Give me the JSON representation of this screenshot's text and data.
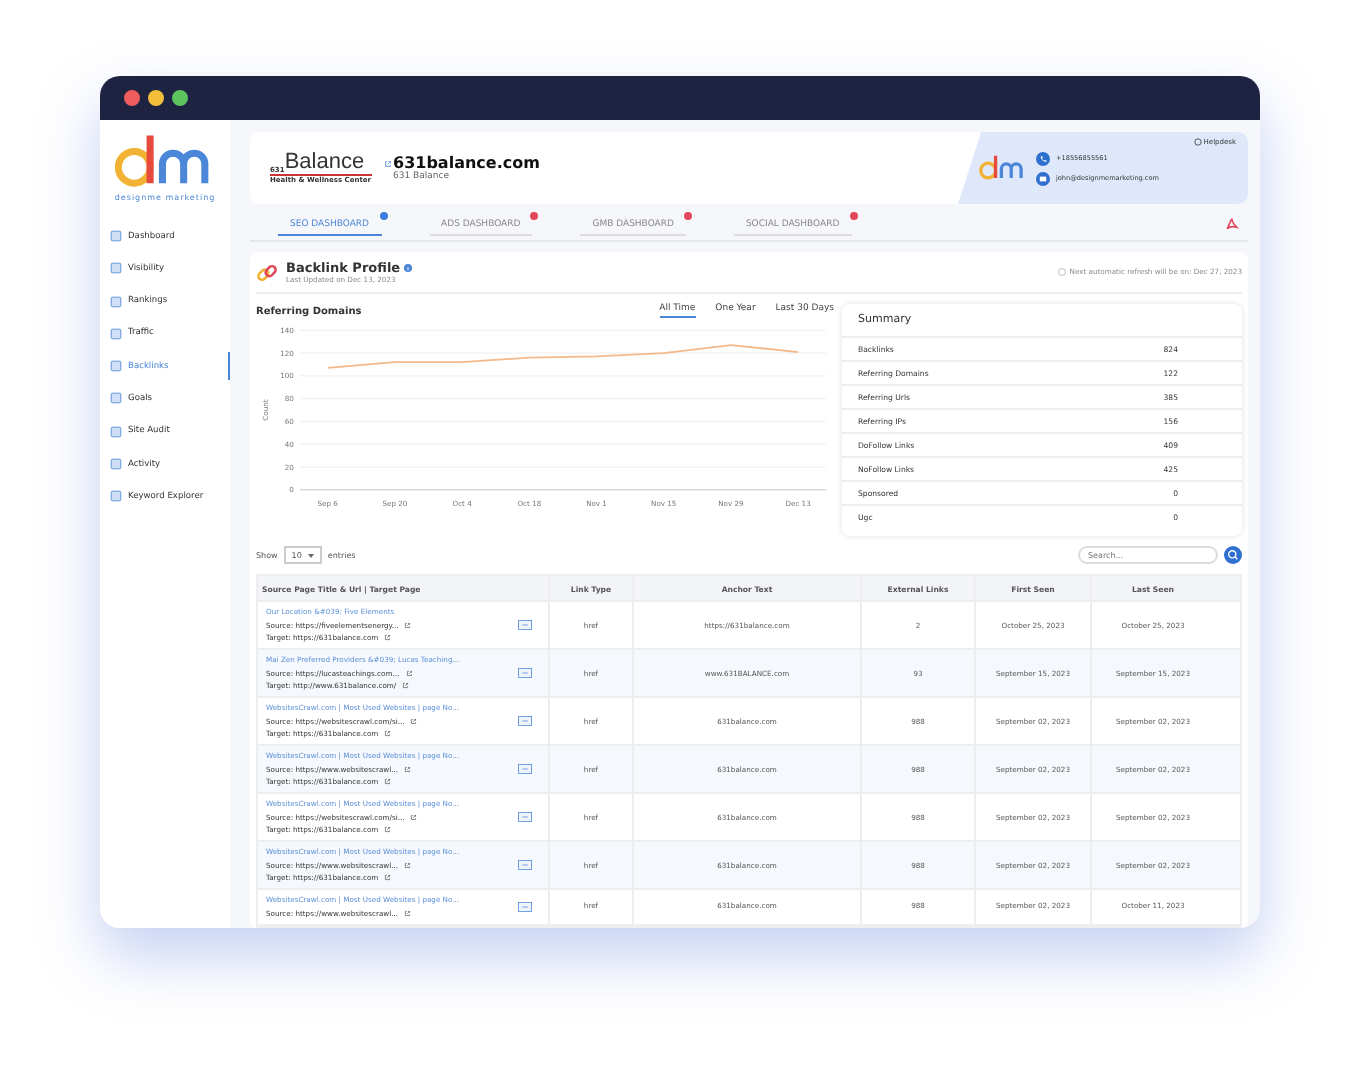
{
  "brand": {
    "logo_text": "designme marketing"
  },
  "sidebar": {
    "items": [
      {
        "label": "Dashboard",
        "selected": false
      },
      {
        "label": "Visibility",
        "selected": false
      },
      {
        "label": "Rankings",
        "selected": false
      },
      {
        "label": "Traffic",
        "selected": false
      },
      {
        "label": "Backlinks",
        "selected": true
      },
      {
        "label": "Goals",
        "selected": false
      },
      {
        "label": "Site Audit",
        "selected": false
      },
      {
        "label": "Activity",
        "selected": false
      },
      {
        "label": "Keyword Explorer",
        "selected": false
      }
    ]
  },
  "client": {
    "logo_prefix": "631",
    "logo_name": "Balance",
    "logo_tagline": "Health & Wellness Center",
    "domain": "631balance.com",
    "name": "631 Balance"
  },
  "contact": {
    "helpdesk": "Helpdesk",
    "phone": "+18556855561",
    "email": "john@designmemarketing.com"
  },
  "tabs": [
    {
      "label": "SEO DASHBOARD",
      "selected": true,
      "color": "#3b7ddd"
    },
    {
      "label": "ADS DASHBOARD",
      "selected": false,
      "color": "#e0475b"
    },
    {
      "label": "GMB DASHBOARD",
      "selected": false,
      "color": "#e0475b"
    },
    {
      "label": "SOCIAL DASHBOARD",
      "selected": false,
      "color": "#e0475b"
    }
  ],
  "profile": {
    "title": "Backlink Profile",
    "updated": "Last Updated on Dec 13, 2023",
    "refresh": "Next automatic refresh will be on: Dec 27, 2023"
  },
  "referring": {
    "title": "Referring Domains",
    "ranges": [
      {
        "label": "All Time",
        "selected": true
      },
      {
        "label": "One Year",
        "selected": false
      },
      {
        "label": "Last 30 Days",
        "selected": false
      }
    ],
    "chart_data": {
      "type": "line",
      "ylabel": "Count",
      "categories": [
        "Sep 6",
        "Sep 20",
        "Oct 4",
        "Oct 18",
        "Nov 1",
        "Nov 15",
        "Nov 29",
        "Dec 13"
      ],
      "grid": true,
      "series": [
        {
          "color": "#f4b98a",
          "values": [
            107,
            112,
            112,
            116,
            117,
            120,
            127,
            121
          ]
        }
      ],
      "ylim": [
        0,
        140
      ],
      "yticks": [
        0,
        20,
        40,
        60,
        80,
        100,
        120,
        140
      ]
    }
  },
  "summary": {
    "title": "Summary",
    "rows": [
      {
        "label": "Backlinks",
        "value": "824"
      },
      {
        "label": "Referring Domains",
        "value": "122"
      },
      {
        "label": "Referring Urls",
        "value": "385"
      },
      {
        "label": "Referring IPs",
        "value": "156"
      },
      {
        "label": "DoFollow Links",
        "value": "409"
      },
      {
        "label": "NoFollow Links",
        "value": "425"
      },
      {
        "label": "Sponsored",
        "value": "0"
      },
      {
        "label": "Ugc",
        "value": "0"
      }
    ]
  },
  "table_controls": {
    "show": "Show",
    "page_size": "10",
    "entries": "entries",
    "search_placeholder": "Search..."
  },
  "table": {
    "columns": [
      "Source Page Title & Url | Target Page",
      "Link Type",
      "Anchor Text",
      "External Links",
      "First Seen",
      "Last Seen"
    ],
    "rows": [
      {
        "title": "Our Location &#039; Five Elements",
        "source": "Source: https://fiveelementsenergy...",
        "target": "Target: https://631balance.com",
        "link_type": "href",
        "anchor": "https://631balance.com",
        "external": "2",
        "first_seen": "October 25, 2023",
        "last_seen": "October 25, 2023"
      },
      {
        "title": "Mai Zen Preferred Providers &#039; Lucas Teaching...",
        "source": "Source: https://lucasteachings.com...",
        "target": "Target: http://www.631balance.com/",
        "link_type": "href",
        "anchor": "www.631BALANCE.com",
        "external": "93",
        "first_seen": "September 15, 2023",
        "last_seen": "September 15, 2023"
      },
      {
        "title": "WebsitesCrawl.com | Most Used Websites | page No...",
        "source": "Source: https://websitescrawl.com/si...",
        "target": "Target: https://631balance.com",
        "link_type": "href",
        "anchor": "631balance.com",
        "external": "988",
        "first_seen": "September 02, 2023",
        "last_seen": "September 02, 2023"
      },
      {
        "title": "WebsitesCrawl.com | Most Used Websites | page No...",
        "source": "Source: https://www.websitescrawl...",
        "target": "Target: https://631balance.com",
        "link_type": "href",
        "anchor": "631balance.com",
        "external": "988",
        "first_seen": "September 02, 2023",
        "last_seen": "September 02, 2023"
      },
      {
        "title": "WebsitesCrawl.com | Most Used Websites | page No...",
        "source": "Source: https://websitescrawl.com/si...",
        "target": "Target: https://631balance.com",
        "link_type": "href",
        "anchor": "631balance.com",
        "external": "988",
        "first_seen": "September 02, 2023",
        "last_seen": "September 02, 2023"
      },
      {
        "title": "WebsitesCrawl.com | Most Used Websites | page No...",
        "source": "Source: https://www.websitescrawl...",
        "target": "Target: https://631balance.com",
        "link_type": "href",
        "anchor": "631balance.com",
        "external": "988",
        "first_seen": "September 02, 2023",
        "last_seen": "September 02, 2023"
      },
      {
        "title": "WebsitesCrawl.com | Most Used Websites | page No...",
        "source": "Source: https://www.websitescrawl...",
        "link_type": "href",
        "anchor": "631balance.com",
        "external": "988",
        "first_seen": "September 02, 2023",
        "last_seen": "October 11, 2023"
      }
    ]
  }
}
